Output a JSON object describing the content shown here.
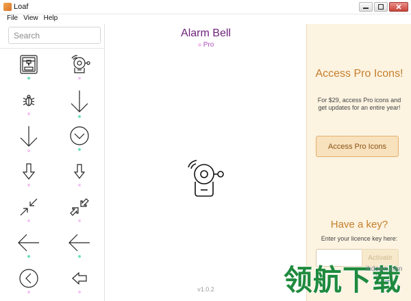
{
  "window": {
    "title": "Loaf"
  },
  "menu": {
    "items": [
      "File",
      "View",
      "Help"
    ]
  },
  "sidebar": {
    "search": {
      "placeholder": "Search",
      "value": ""
    },
    "icons": [
      {
        "icon": "3d-printer-icon",
        "dot": "#6fe0b8"
      },
      {
        "icon": "alarm-bell-icon",
        "dot": "#f3c6f4"
      },
      {
        "icon": "bug-icon",
        "dot": "#f3c6f4"
      },
      {
        "icon": "arrow-down-icon",
        "dot": "#6fe0b8"
      },
      {
        "icon": "arrow-down-thin-icon",
        "dot": "#f3c6f4"
      },
      {
        "icon": "arrow-down-circle-icon",
        "dot": "#6fe0b8"
      },
      {
        "icon": "arrow-down-outline-icon",
        "dot": "#f3c6f4"
      },
      {
        "icon": "arrow-down-outline-small-icon",
        "dot": "#f3c6f4"
      },
      {
        "icon": "arrows-collapse-icon",
        "dot": "#f3c6f4"
      },
      {
        "icon": "arrows-collapse-outline-icon",
        "dot": "#f3c6f4"
      },
      {
        "icon": "arrow-left-icon",
        "dot": "#6fe0b8"
      },
      {
        "icon": "arrow-left-long-icon",
        "dot": "#6fe0b8"
      },
      {
        "icon": "arrow-left-circle-icon",
        "dot": "#f3c6f4"
      },
      {
        "icon": "arrow-left-outline-icon",
        "dot": "#f3c6f4"
      }
    ]
  },
  "preview": {
    "name": "Alarm Bell",
    "tag": "Pro",
    "tag_color": "#f3c6f4",
    "version": "v1.0.2"
  },
  "promo": {
    "title": "Access Pro Icons!",
    "description": "For $29, access Pro icons and get updates for an entire year!",
    "button": "Access Pro Icons",
    "key_title": "Have a key?",
    "key_description": "Enter your licence key here:",
    "key_value": "",
    "activate": "Activate",
    "contact": "Conta"
  },
  "watermark": {
    "domain": "ihdown.com",
    "text": "领航下载"
  },
  "colors": {
    "accent": "#c57e2a",
    "promo_bg": "#fcf3e1",
    "free_dot": "#6fe0b8",
    "pro_dot": "#f3c6f4",
    "title": "#6d1f7a"
  }
}
